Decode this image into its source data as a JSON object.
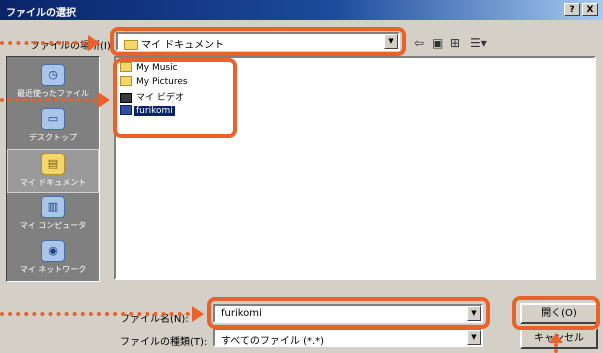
{
  "window": {
    "title": "ファイルの選択",
    "help_button": "?",
    "close_button": "X"
  },
  "look_in": {
    "label": "ファイルの場所(I):",
    "value": "マイ ドキュメント"
  },
  "toolbar": {
    "back_icon": "back-arrow-icon",
    "up_folder_icon": "up-folder-icon",
    "new_folder_icon": "new-folder-icon",
    "view_menu_icon": "view-menu-icon"
  },
  "places_bar": {
    "items": [
      {
        "label": "最近使ったファイル",
        "icon": "recent-files-icon"
      },
      {
        "label": "デスクトップ",
        "icon": "desktop-icon"
      },
      {
        "label": "マイ ドキュメント",
        "icon": "my-documents-icon",
        "active": true
      },
      {
        "label": "マイ コンピュータ",
        "icon": "my-computer-icon"
      },
      {
        "label": "マイ ネットワーク",
        "icon": "my-network-icon"
      }
    ]
  },
  "file_list": {
    "items": [
      {
        "name": "My Music",
        "icon": "folder-icon"
      },
      {
        "name": "My Pictures",
        "icon": "folder-icon"
      },
      {
        "name": "マイ ビデオ",
        "icon": "video-folder-icon"
      },
      {
        "name": "furikomi",
        "icon": "file-icon",
        "selected": true
      }
    ]
  },
  "file_name": {
    "label": "ファイル名(N):",
    "value": "furikomi"
  },
  "file_type": {
    "label": "ファイルの種類(T):",
    "value": "すべてのファイル (*.*)"
  },
  "buttons": {
    "open": "開く(O)",
    "cancel": "キャンセル"
  },
  "colors": {
    "highlight": "#e8622a",
    "title_bar": "#0a246a",
    "dialog_bg": "#d4d0c8"
  }
}
